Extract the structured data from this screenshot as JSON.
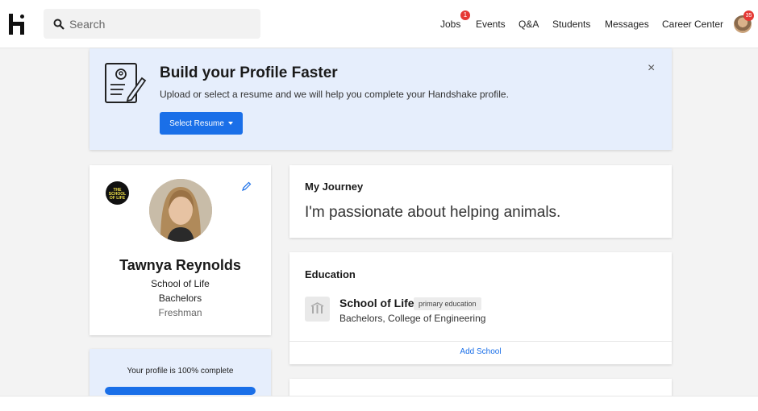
{
  "search": {
    "placeholder": "Search"
  },
  "nav": {
    "items": [
      {
        "label": "Jobs",
        "badge": "1"
      },
      {
        "label": "Events"
      },
      {
        "label": "Q&A"
      },
      {
        "label": "Students"
      },
      {
        "label": "Messages"
      },
      {
        "label": "Career Center"
      }
    ],
    "avatar_badge": "35"
  },
  "banner": {
    "title": "Build your Profile Faster",
    "text": "Upload or select a resume and we will help you complete your Handshake profile.",
    "button": "Select Resume",
    "close": "×"
  },
  "profile": {
    "school_logo_text": "THE SCHOOL OF LIFE",
    "name": "Tawnya Reynolds",
    "school": "School of Life",
    "degree": "Bachelors",
    "year": "Freshman"
  },
  "completion": {
    "text": "Your profile is 100% complete",
    "percent": 100
  },
  "journey": {
    "title": "My Journey",
    "text": "I'm passionate about helping animals."
  },
  "education": {
    "title": "Education",
    "school": "School of Life",
    "tag": "primary education",
    "degree": "Bachelors, College of Engineering",
    "add_label": "Add School"
  },
  "colors": {
    "accent": "#1a6fe8",
    "banner_bg": "#e6eefc",
    "badge": "#e53935"
  }
}
